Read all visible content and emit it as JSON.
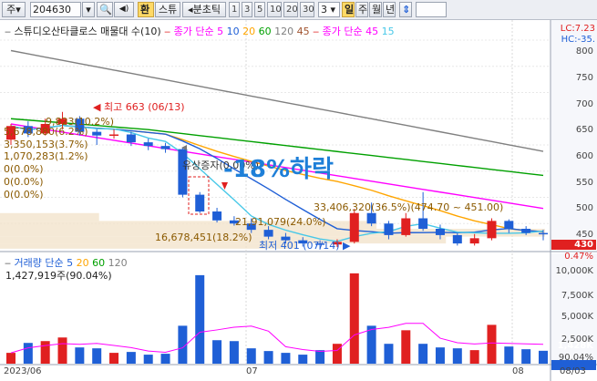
{
  "toolbar": {
    "mode_label": "주",
    "code_value": "204630",
    "tab_quote": "환",
    "tab_stock": "스튜",
    "period_label": "분초틱",
    "periods": [
      "1",
      "3",
      "5",
      "10",
      "20",
      "30"
    ],
    "interval_value": "3",
    "day_btn": "일",
    "week_btn": "주",
    "month_btn": "월",
    "year_btn": "년"
  },
  "legend": {
    "title": "스튜디오산타클로스 매물대 수(10)",
    "ma_label": "종가 단순 5",
    "ma_values": [
      "10",
      "20",
      "60",
      "120",
      "45"
    ],
    "ma2_label": "종가 단순 45",
    "ma2_value": "15"
  },
  "corner": {
    "lc": "LC:7.23",
    "hc": "HC:-35."
  },
  "annotations": {
    "high": "최고 663 (06/13)",
    "low": "최저 401 (07/14)",
    "rights": "유상증자(0.00%)",
    "drop": "-18%하락",
    "vol_row1": "9,823(10.2%)",
    "vol_row2": "5,678,880(6.2%)",
    "vol_row3": "3,350,153(3.7%)",
    "vol_row4": "1,070,283(1.2%)",
    "zero": "0(0.0%)",
    "mid1": "33,406,320(36.5%)(474.70 ~ 451.00)",
    "mid2": "21,91,079(24.0%)",
    "mid3": "16,678,451(18.2%)"
  },
  "price_axis": {
    "ticks": [
      "800",
      "750",
      "700",
      "650",
      "600",
      "550",
      "500",
      "450",
      "430",
      "0.47%"
    ],
    "current": "430",
    "current_pct": "0.47%"
  },
  "volume": {
    "legend_label": "거래량 단순 5",
    "legend_values": [
      "20",
      "60",
      "120"
    ],
    "summary": "1,427,919주(90.04%)",
    "ticks": [
      "10,000K",
      "7,500K",
      "5,000K",
      "2,500K",
      "1,428K",
      "90.04%"
    ]
  },
  "x_axis": [
    "2023/06",
    "07",
    "08",
    "08/03"
  ],
  "colors": {
    "up": "#e02020",
    "down": "#1f5fd6",
    "ma5": "#ff00ff",
    "ma20": "#ffa500",
    "ma60": "#00a000",
    "ma120": "#808080",
    "accent": "#1e7fd8"
  },
  "chart_data": {
    "type": "candlestick",
    "title": "스튜디오산타클로스",
    "candles": [
      {
        "o": 610,
        "c": 636,
        "h": 640,
        "l": 600
      },
      {
        "o": 636,
        "c": 622,
        "h": 645,
        "l": 615
      },
      {
        "o": 622,
        "c": 640,
        "h": 650,
        "l": 618
      },
      {
        "o": 640,
        "c": 650,
        "h": 663,
        "l": 630
      },
      {
        "o": 650,
        "c": 625,
        "h": 655,
        "l": 618
      },
      {
        "o": 625,
        "c": 618,
        "h": 630,
        "l": 600
      },
      {
        "o": 618,
        "c": 620,
        "h": 630,
        "l": 612
      },
      {
        "o": 620,
        "c": 605,
        "h": 625,
        "l": 598
      },
      {
        "o": 605,
        "c": 598,
        "h": 612,
        "l": 590
      },
      {
        "o": 598,
        "c": 592,
        "h": 604,
        "l": 585
      },
      {
        "o": 592,
        "c": 505,
        "h": 595,
        "l": 500
      },
      {
        "o": 505,
        "c": 473,
        "h": 510,
        "l": 470
      },
      {
        "o": 473,
        "c": 456,
        "h": 480,
        "l": 452
      },
      {
        "o": 456,
        "c": 450,
        "h": 464,
        "l": 446
      },
      {
        "o": 450,
        "c": 438,
        "h": 460,
        "l": 432
      },
      {
        "o": 438,
        "c": 425,
        "h": 445,
        "l": 420
      },
      {
        "o": 425,
        "c": 418,
        "h": 432,
        "l": 412
      },
      {
        "o": 418,
        "c": 412,
        "h": 424,
        "l": 406
      },
      {
        "o": 412,
        "c": 410,
        "h": 418,
        "l": 401
      },
      {
        "o": 410,
        "c": 415,
        "h": 420,
        "l": 405
      },
      {
        "o": 415,
        "c": 470,
        "h": 478,
        "l": 412
      },
      {
        "o": 470,
        "c": 450,
        "h": 490,
        "l": 445
      },
      {
        "o": 450,
        "c": 428,
        "h": 455,
        "l": 420
      },
      {
        "o": 428,
        "c": 460,
        "h": 470,
        "l": 425
      },
      {
        "o": 460,
        "c": 440,
        "h": 510,
        "l": 436
      },
      {
        "o": 440,
        "c": 428,
        "h": 448,
        "l": 420
      },
      {
        "o": 428,
        "c": 412,
        "h": 432,
        "l": 408
      },
      {
        "o": 412,
        "c": 422,
        "h": 430,
        "l": 408
      },
      {
        "o": 422,
        "c": 455,
        "h": 460,
        "l": 418
      },
      {
        "o": 455,
        "c": 440,
        "h": 458,
        "l": 432
      },
      {
        "o": 440,
        "c": 432,
        "h": 445,
        "l": 428
      },
      {
        "o": 432,
        "c": 430,
        "h": 438,
        "l": 418
      }
    ],
    "volumes": [
      1200,
      2300,
      2500,
      2900,
      1800,
      1700,
      1200,
      1300,
      1000,
      1100,
      4200,
      9800,
      2600,
      2500,
      1700,
      1400,
      1200,
      1000,
      1500,
      2200,
      10000,
      4200,
      2200,
      3700,
      2200,
      1800,
      1700,
      1500,
      4300,
      1900,
      1600,
      1428
    ],
    "ylim": [
      400,
      800
    ],
    "vol_ylim": [
      0,
      11000
    ]
  }
}
